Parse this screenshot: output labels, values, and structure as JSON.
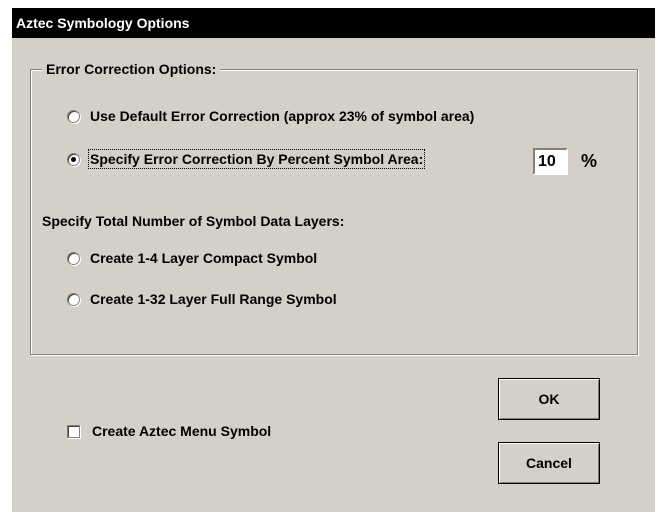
{
  "dialog": {
    "title": "Aztec Symbology Options"
  },
  "error_correction": {
    "group_label": "Error Correction Options:",
    "default_option": "Use Default Error Correction (approx 23% of symbol area)",
    "default_selected": false,
    "percent_option": "Specify Error Correction By Percent Symbol Area:",
    "percent_selected": true,
    "percent_value": "10",
    "percent_sign": "%"
  },
  "layers": {
    "heading": "Specify Total Number of Symbol Data Layers:",
    "compact_option": "Create 1-4 Layer Compact Symbol",
    "compact_selected": false,
    "full_option": "Create 1-32 Layer Full Range Symbol",
    "full_selected": false
  },
  "menu_symbol": {
    "label": "Create Aztec Menu Symbol",
    "checked": false
  },
  "buttons": {
    "ok": "OK",
    "cancel": "Cancel"
  }
}
